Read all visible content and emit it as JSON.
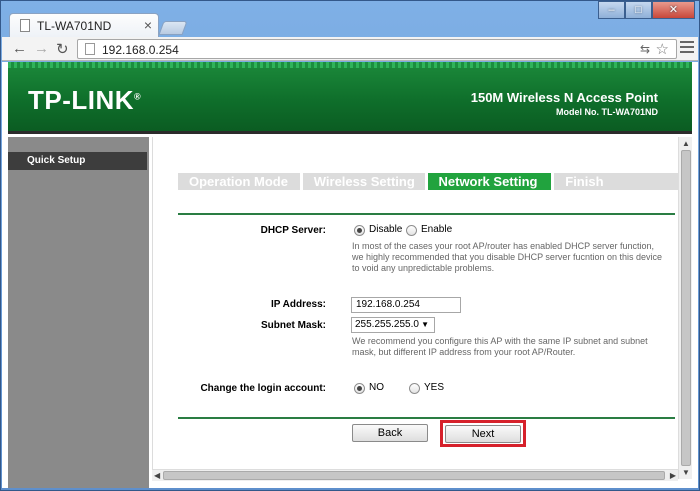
{
  "browser": {
    "tab_title": "TL-WA701ND",
    "tab_close": "×",
    "url": "192.168.0.254",
    "window_buttons": [
      "–",
      "□",
      "✕"
    ]
  },
  "header": {
    "logo": "TP-LINK",
    "logo_mark": "®",
    "product": "150M Wireless N Access Point",
    "model": "Model No. TL-WA701ND"
  },
  "sidebar": {
    "items": [
      {
        "label": "Quick Setup"
      }
    ]
  },
  "steps": [
    {
      "label": "Operation Mode",
      "active": false
    },
    {
      "label": "Wireless Setting",
      "active": false
    },
    {
      "label": "Network Setting",
      "active": true
    },
    {
      "label": "Finish",
      "active": false
    }
  ],
  "form": {
    "dhcp": {
      "label": "DHCP Server:",
      "options": [
        "Disable",
        "Enable"
      ],
      "selected": "Disable",
      "note": [
        "In most of the cases your root AP/router has enabled DHCP server function,",
        "we highly recommended that you disable DHCP server fucntion on this device",
        "to void any unpredictable problems."
      ]
    },
    "ip": {
      "label": "IP Address:",
      "value": "192.168.0.254"
    },
    "mask": {
      "label": "Subnet Mask:",
      "value": "255.255.255.0",
      "note": [
        "We recommend you configure this AP with the same IP subnet and subnet",
        "mask, but different IP address from your root AP/Router."
      ]
    },
    "login": {
      "label": "Change the login account:",
      "options": [
        "NO",
        "YES"
      ],
      "selected": "NO"
    }
  },
  "buttons": {
    "back": "Back",
    "next": "Next"
  },
  "colors": {
    "brand_green": "#0f6f2b",
    "active_step": "#21a33e",
    "highlight": "#d6212b"
  }
}
